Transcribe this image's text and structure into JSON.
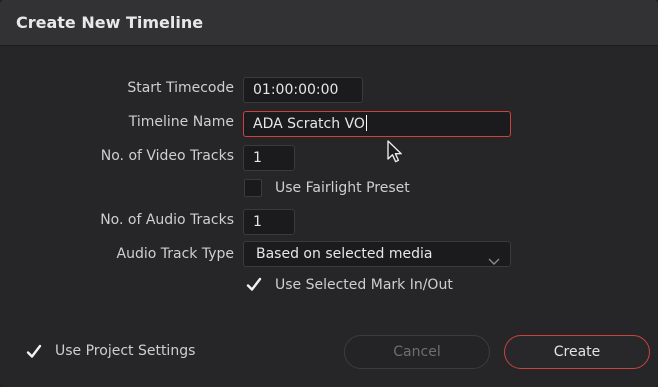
{
  "dialog": {
    "title": "Create New Timeline"
  },
  "form": {
    "start_timecode_label": "Start Timecode",
    "start_timecode_value": "01:00:00:00",
    "timeline_name_label": "Timeline Name",
    "timeline_name_value": "ADA Scratch VO",
    "video_tracks_label": "No. of Video Tracks",
    "video_tracks_value": "1",
    "fairlight_preset_label": "Use Fairlight Preset",
    "fairlight_preset_checked": false,
    "audio_tracks_label": "No. of Audio Tracks",
    "audio_tracks_value": "1",
    "audio_track_type_label": "Audio Track Type",
    "audio_track_type_value": "Based on selected media",
    "mark_in_out_label": "Use Selected Mark In/Out",
    "mark_in_out_checked": true
  },
  "footer": {
    "project_settings_label": "Use Project Settings",
    "project_settings_checked": true,
    "cancel_label": "Cancel",
    "create_label": "Create"
  },
  "icons": {
    "check": "check-icon",
    "chevron": "chevron-down-icon",
    "cursor": "mouse-pointer-icon"
  },
  "colors": {
    "accent": "#c9433d",
    "background": "#262628",
    "titlebar": "#323234"
  }
}
